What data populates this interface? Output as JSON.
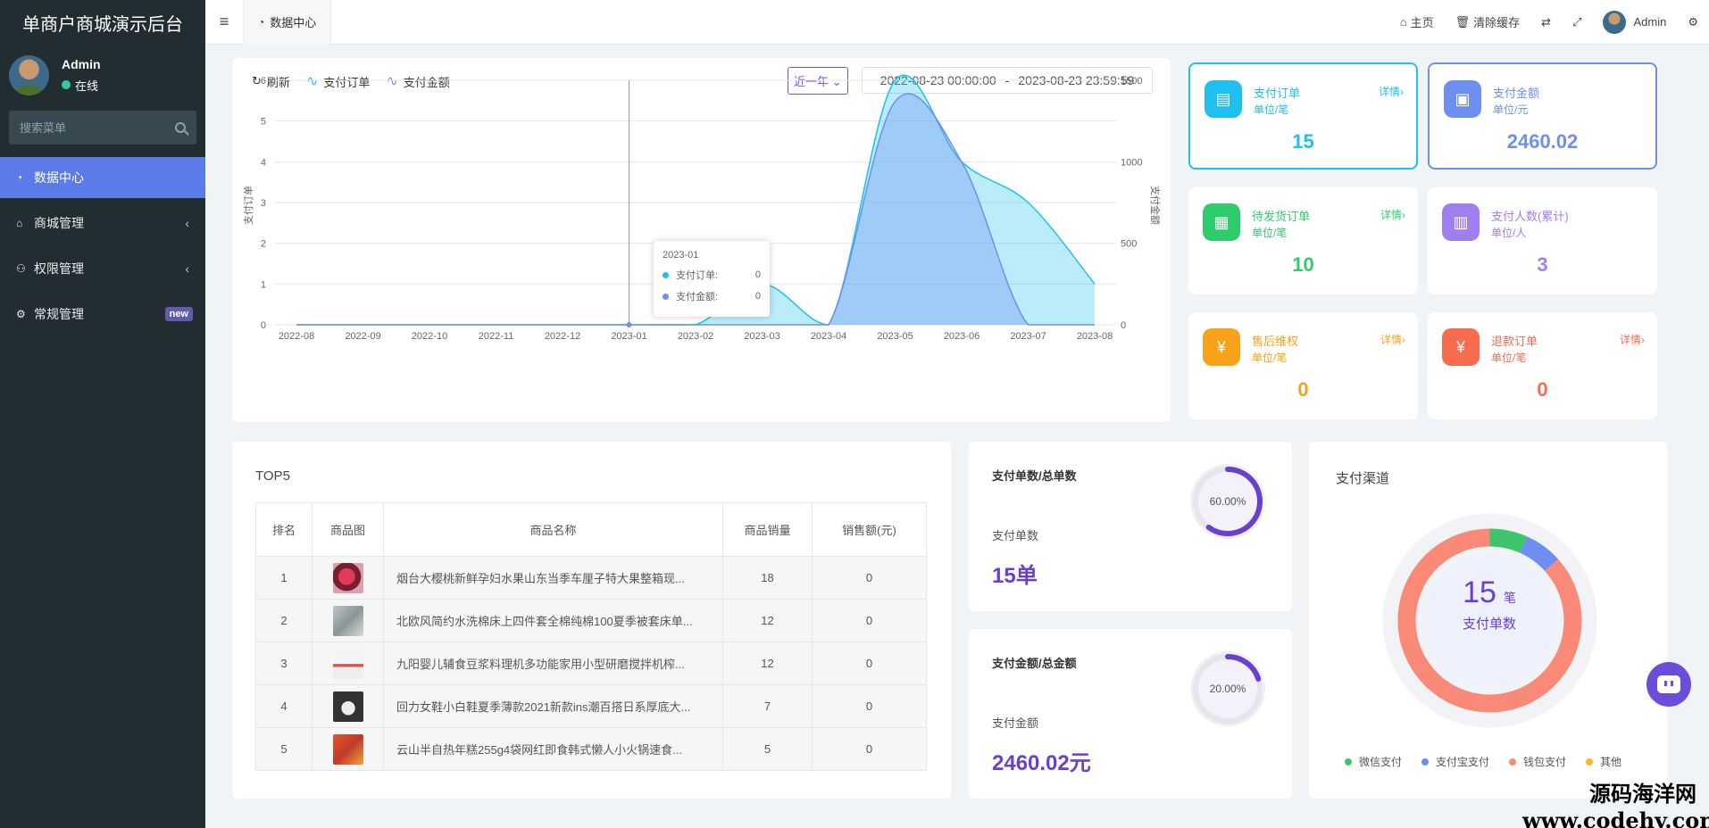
{
  "app": {
    "title": "单商户商城演示后台"
  },
  "user": {
    "name": "Admin",
    "status": "在线"
  },
  "sidebar": {
    "search_placeholder": "搜索菜单",
    "items": [
      {
        "label": "数据中心",
        "icon": "dashboard-icon",
        "active": true
      },
      {
        "label": "商城管理",
        "icon": "home-icon"
      },
      {
        "label": "权限管理",
        "icon": "users-icon"
      },
      {
        "label": "常规管理",
        "icon": "cogs-icon",
        "badge": "new"
      }
    ]
  },
  "topbar": {
    "tab": "数据中心",
    "home": "主页",
    "clear_cache": "清除缓存",
    "admin": "Admin"
  },
  "chart_card": {
    "refresh": "刷新",
    "legend_orders": "支付订单",
    "legend_amount": "支付金额",
    "range": "近一年",
    "date_from": "2022-08-23 00:00:00",
    "date_sep": "-",
    "date_to": "2023-08-23 23:59:59",
    "tooltip": {
      "title": "2023-01",
      "orders_label": "支付订单:",
      "orders_value": "0",
      "amount_label": "支付金额:",
      "amount_value": "0"
    }
  },
  "chart_data": {
    "type": "area",
    "categories": [
      "2022-08",
      "2022-09",
      "2022-10",
      "2022-11",
      "2022-12",
      "2023-01",
      "2023-02",
      "2023-03",
      "2023-04",
      "2023-05",
      "2023-06",
      "2023-07",
      "2023-08"
    ],
    "series": [
      {
        "name": "支付订单",
        "axis": "left",
        "color": "#1ec0f0",
        "values": [
          0,
          0,
          0,
          0,
          0,
          0,
          0,
          1,
          0,
          6,
          4,
          3,
          1
        ]
      },
      {
        "name": "支付金额",
        "axis": "right",
        "color": "#6e8ff0",
        "values": [
          0,
          0,
          0,
          0,
          0,
          0,
          0,
          0,
          0,
          1370,
          1000,
          0,
          0
        ]
      }
    ],
    "ylabel": "支付订单",
    "y2label": "支付金额",
    "ylim": [
      0,
      6
    ],
    "y2lim": [
      0,
      1500
    ],
    "yticks": [
      "0",
      "1",
      "2",
      "3",
      "4",
      "5",
      "6"
    ],
    "y2ticks": [
      "0",
      "500",
      "1000",
      "1500"
    ],
    "grid": true
  },
  "stats": [
    {
      "title": "支付订单",
      "unit": "单位/笔",
      "value": "15",
      "detail": "详情›",
      "color": "#1ec0f0",
      "icon": "document-icon",
      "highlight": true
    },
    {
      "title": "支付金额",
      "unit": "单位/元",
      "value": "2460.02",
      "detail": "",
      "color": "#6e8ff0",
      "icon": "wallet-icon",
      "highlight": true
    },
    {
      "title": "待发货订单",
      "unit": "单位/笔",
      "value": "10",
      "detail": "详情›",
      "color": "#2fcc6c",
      "icon": "calendar-icon"
    },
    {
      "title": "支付人数(累计)",
      "unit": "单位/人",
      "value": "3",
      "detail": "",
      "color": "#a07ef0",
      "icon": "bar-chart-icon"
    },
    {
      "title": "售后维权",
      "unit": "单位/笔",
      "value": "0",
      "detail": "详情›",
      "color": "#f7a218",
      "icon": "shield-yen-icon"
    },
    {
      "title": "退款订单",
      "unit": "单位/笔",
      "value": "0",
      "detail": "详情›",
      "color": "#f76b4e",
      "icon": "refund-yen-icon"
    }
  ],
  "top5": {
    "title": "TOP5",
    "headers": [
      "排名",
      "商品图",
      "商品名称",
      "商品销量",
      "销售额(元)"
    ],
    "rows": [
      {
        "rank": "1",
        "name": "烟台大樱桃新鲜孕妇水果山东当季车厘子特大果整箱现...",
        "sales": "18",
        "amount": "0"
      },
      {
        "rank": "2",
        "name": "北欧风简约水洗棉床上四件套全棉纯棉100夏季被套床单...",
        "sales": "12",
        "amount": "0"
      },
      {
        "rank": "3",
        "name": "九阳婴儿辅食豆浆料理机多功能家用小型研磨搅拌机榨...",
        "sales": "12",
        "amount": "0"
      },
      {
        "rank": "4",
        "name": "回力女鞋小白鞋夏季薄款2021新款ins潮百搭日系厚底大...",
        "sales": "7",
        "amount": "0"
      },
      {
        "rank": "5",
        "name": "云山半自热年糕255g4袋网红即食韩式懒人小火锅速食...",
        "sales": "5",
        "amount": "0"
      }
    ]
  },
  "ratio_orders": {
    "title": "支付单数/总单数",
    "label": "支付单数",
    "value": "15单",
    "percent_text": "60.00%",
    "percent": 0.6
  },
  "ratio_amount": {
    "title": "支付金额/总金额",
    "label": "支付金额",
    "value": "2460.02元",
    "percent_text": "20.00%",
    "percent": 0.2
  },
  "pay_channel": {
    "title": "支付渠道",
    "center_value": "15",
    "center_unit": "笔",
    "center_label": "支付单数",
    "slices": [
      {
        "name": "微信支付",
        "value": 1,
        "color": "#3ec46d"
      },
      {
        "name": "支付宝支付",
        "value": 1,
        "color": "#6e8ff0"
      },
      {
        "name": "钱包支付",
        "value": 13,
        "color": "#f98a78"
      },
      {
        "name": "其他",
        "value": 0,
        "color": "#f7b924"
      }
    ]
  },
  "watermark": {
    "line1": "源码海洋网",
    "line2": "www.codehy.com"
  }
}
